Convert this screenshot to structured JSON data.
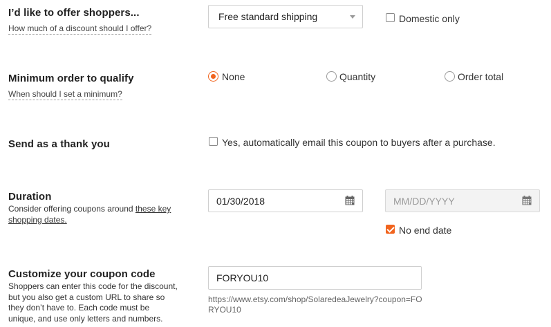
{
  "offer": {
    "title": "I’d like to offer shoppers...",
    "help": "How much of a discount should I offer?",
    "select_value": "Free standard shipping",
    "domestic_label": "Domestic only"
  },
  "minimum": {
    "title": "Minimum order to qualify",
    "help": "When should I set a minimum?",
    "options": [
      "None",
      "Quantity",
      "Order total"
    ],
    "selected": "None"
  },
  "thankyou": {
    "title": "Send as a thank you",
    "checkbox_label": "Yes, automatically email this coupon to buyers after a purchase."
  },
  "duration": {
    "title": "Duration",
    "desc_prefix": "Consider offering coupons around ",
    "desc_link": "these key shopping dates.",
    "start_date": "01/30/2018",
    "end_placeholder": "MM/DD/YYYY",
    "no_end_label": "No end date"
  },
  "code": {
    "title": "Customize your coupon code",
    "desc": "Shoppers can enter this code for the discount, but you also get a custom URL to share so they don’t have to. Each code must be unique, and use only letters and numbers.",
    "value": "FORYOU10",
    "url": "https://www.etsy.com/shop/SolaredeaJewelry?coupon=FORYOU10"
  },
  "colors": {
    "accent": "#f1641e"
  },
  "icons": [
    "caret-down-icon",
    "calendar-icon",
    "check-icon"
  ]
}
